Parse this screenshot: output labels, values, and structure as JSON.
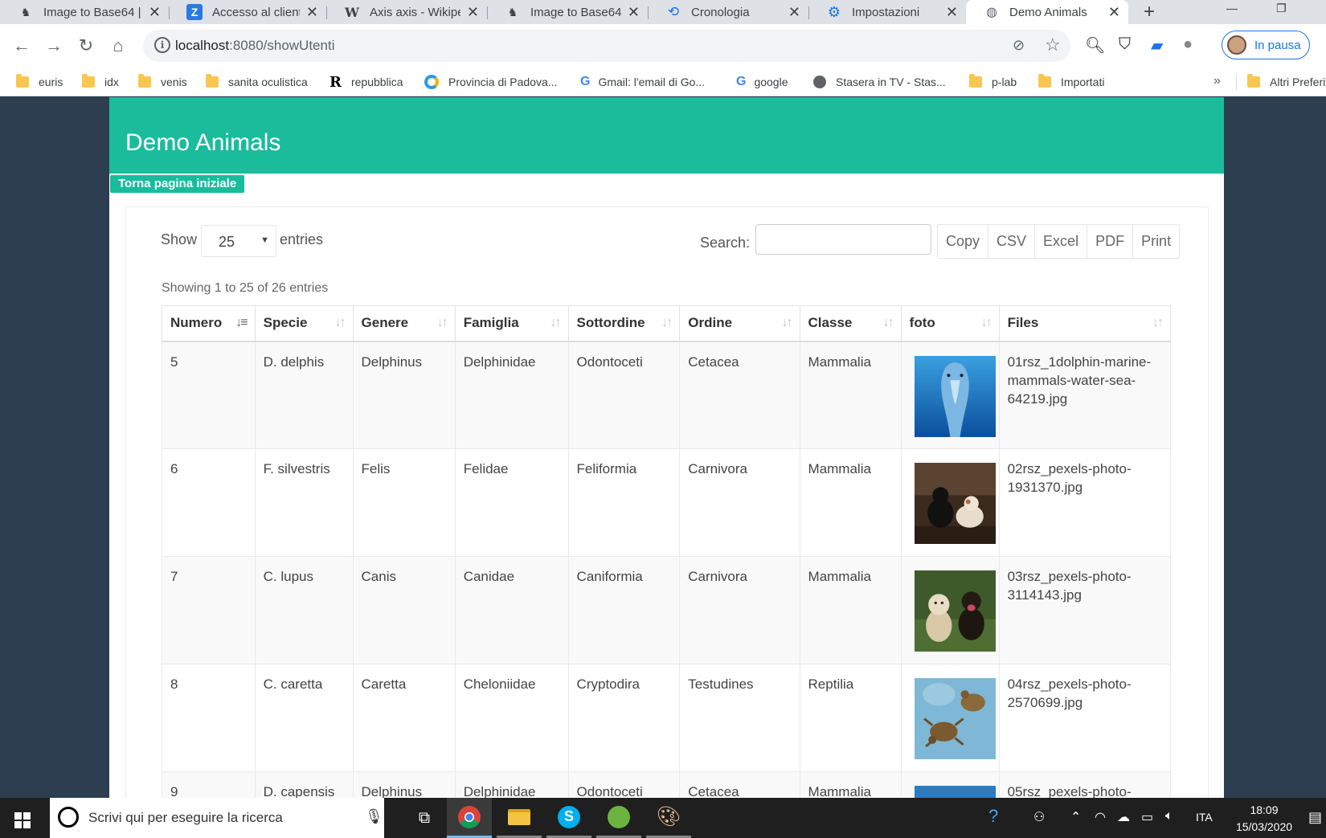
{
  "browser": {
    "tabs": [
      {
        "title": "Image to Base64 |",
        "icon": "person-icon",
        "active": false
      },
      {
        "title": "Accesso al client W",
        "icon": "z-icon",
        "active": false
      },
      {
        "title": "Axis axis - Wikiped",
        "icon": "wikipedia-icon",
        "active": false
      },
      {
        "title": "Image to Base64 |",
        "icon": "person-icon",
        "active": false
      },
      {
        "title": "Cronologia",
        "icon": "history-icon",
        "active": false
      },
      {
        "title": "Impostazioni",
        "icon": "gear-icon",
        "active": false
      },
      {
        "title": "Demo Animals",
        "icon": "globe-icon",
        "active": true
      }
    ],
    "close_glyph": "✕",
    "new_tab_glyph": "+",
    "url_host": "localhost",
    "url_path": ":8080/showUtenti",
    "profile_label": "In pausa",
    "bookmarks": [
      {
        "label": "euris",
        "icon": "folder-icon"
      },
      {
        "label": "idx",
        "icon": "folder-icon"
      },
      {
        "label": "venis",
        "icon": "folder-icon"
      },
      {
        "label": "sanita oculistica",
        "icon": "folder-icon"
      },
      {
        "label": "repubblica",
        "icon": "repubblica-icon"
      },
      {
        "label": "Provincia di Padova...",
        "icon": "padova-icon"
      },
      {
        "label": "Gmail: l'email di Go...",
        "icon": "google-icon"
      },
      {
        "label": "google",
        "icon": "google-icon"
      },
      {
        "label": "Stasera in TV - Stas...",
        "icon": "globe-icon"
      },
      {
        "label": "p-lab",
        "icon": "folder-icon"
      },
      {
        "label": "Importati",
        "icon": "folder-icon"
      }
    ],
    "bookmarks_more": "»",
    "other_bookmarks": "Altri Preferiti"
  },
  "page": {
    "header_title": "Demo Animals",
    "back_button": "Torna pagina iniziale",
    "show_label": "Show",
    "page_length": "25",
    "entries_label": "entries",
    "search_label": "Search:",
    "search_value": "",
    "export_buttons": [
      "Copy",
      "CSV",
      "Excel",
      "PDF",
      "Print"
    ],
    "info_text": "Showing 1 to 25 of 26 entries",
    "columns": [
      "Numero",
      "Specie",
      "Genere",
      "Famiglia",
      "Sottordine",
      "Ordine",
      "Classe",
      "foto",
      "Files"
    ],
    "sorted_column": "Numero",
    "rows": [
      {
        "numero": "5",
        "specie": "D. delphis",
        "genere": "Delphinus",
        "famiglia": "Delphinidae",
        "sottordine": "Odontoceti",
        "ordine": "Cetacea",
        "classe": "Mammalia",
        "foto": "dolphin-photo",
        "file": "01rsz_1dolphin-marine-mammals-water-sea-64219.jpg"
      },
      {
        "numero": "6",
        "specie": "F. silvestris",
        "genere": "Felis",
        "famiglia": "Felidae",
        "sottordine": "Feliformia",
        "ordine": "Carnivora",
        "classe": "Mammalia",
        "foto": "cats-photo",
        "file": "02rsz_pexels-photo-1931370.jpg"
      },
      {
        "numero": "7",
        "specie": "C. lupus",
        "genere": "Canis",
        "famiglia": "Canidae",
        "sottordine": "Caniformia",
        "ordine": "Carnivora",
        "classe": "Mammalia",
        "foto": "dogs-photo",
        "file": "03rsz_pexels-photo-3114143.jpg"
      },
      {
        "numero": "8",
        "specie": "C. caretta",
        "genere": "Caretta",
        "famiglia": "Cheloniidae",
        "sottordine": "Cryptodira",
        "ordine": "Testudines",
        "classe": "Reptilia",
        "foto": "turtles-photo",
        "file": "04rsz_pexels-photo-2570699.jpg"
      },
      {
        "numero": "9",
        "specie": "D. capensis",
        "genere": "Delphinus",
        "famiglia": "Delphinidae",
        "sottordine": "Odontoceti",
        "ordine": "Cetacea",
        "classe": "Mammalia",
        "foto": "dolphin-photo",
        "file": "05rsz_pexels-photo-"
      }
    ]
  },
  "taskbar": {
    "search_placeholder": "Scrivi qui per eseguire la ricerca",
    "language": "ITA",
    "time": "18:09",
    "date": "15/03/2020"
  },
  "colors": {
    "header": "#1abc9c",
    "page_background": "#2c3e50",
    "accent_blue": "#1a73e8"
  }
}
